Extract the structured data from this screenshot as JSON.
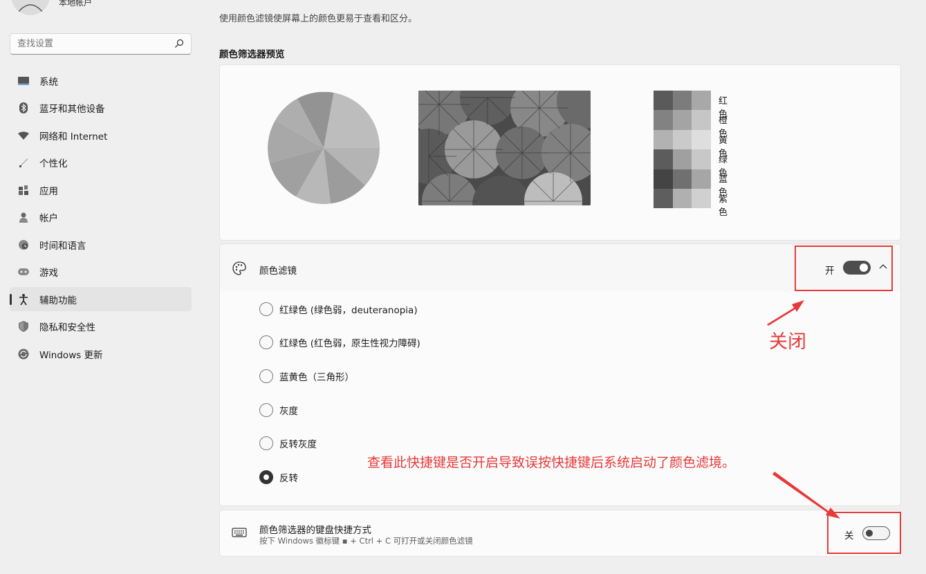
{
  "sidebar": {
    "account_name": "本地帐户",
    "search_placeholder": "查找设置",
    "items": [
      {
        "label": "系统",
        "icon": "monitor-icon"
      },
      {
        "label": "蓝牙和其他设备",
        "icon": "bluetooth-icon"
      },
      {
        "label": "网络和 Internet",
        "icon": "wifi-icon"
      },
      {
        "label": "个性化",
        "icon": "brush-icon"
      },
      {
        "label": "应用",
        "icon": "apps-icon"
      },
      {
        "label": "帐户",
        "icon": "person-icon"
      },
      {
        "label": "时间和语言",
        "icon": "globe-clock-icon"
      },
      {
        "label": "游戏",
        "icon": "gamepad-icon"
      },
      {
        "label": "辅助功能",
        "icon": "accessibility-icon",
        "active": true
      },
      {
        "label": "隐私和安全性",
        "icon": "shield-icon"
      },
      {
        "label": "Windows 更新",
        "icon": "update-icon"
      }
    ]
  },
  "main": {
    "intro": "使用颜色滤镜使屏幕上的颜色更易于查看和区分。",
    "preview_title": "颜色筛选器预览",
    "swatch_labels": [
      "红色",
      "橙色",
      "黄色",
      "绿色",
      "蓝色",
      "紫色"
    ],
    "swatch_colors": [
      [
        "#5a5a5a",
        "#7c7c7c",
        "#a8a8a8"
      ],
      [
        "#828282",
        "#a4a4a4",
        "#c6c6c6"
      ],
      [
        "#b2b2b2",
        "#cacaca",
        "#dedede"
      ],
      [
        "#5c5c5c",
        "#a0a0a0",
        "#c8c8c8"
      ],
      [
        "#444444",
        "#707070",
        "#a6a6a6"
      ],
      [
        "#5e5e5e",
        "#b0b0b0",
        "#d0d0d0"
      ]
    ],
    "filter": {
      "title": "颜色滤镜",
      "state_label": "开",
      "enabled": true,
      "icon": "palette-icon",
      "options": [
        {
          "label": "红绿色 (绿色弱，deuteranopia)",
          "checked": false
        },
        {
          "label": "红绿色 (红色弱，原生性视力障碍)",
          "checked": false
        },
        {
          "label": "蓝黄色（三角形）",
          "checked": false
        },
        {
          "label": "灰度",
          "checked": false
        },
        {
          "label": "反转灰度",
          "checked": false
        },
        {
          "label": "反转",
          "checked": true
        }
      ]
    },
    "shortcut": {
      "title": "颜色筛选器的键盘快捷方式",
      "description": "按下 Windows 徽标键 ▪ + Ctrl + C 可打开或关闭颜色滤镜",
      "state_label": "关",
      "enabled": false,
      "icon": "keyboard-icon"
    }
  },
  "annotations": {
    "close_label": "关闭",
    "note": "查看此快捷键是否开启导致误按快捷键后系统启动了颜色滤境。",
    "color": "#e63a3a"
  }
}
